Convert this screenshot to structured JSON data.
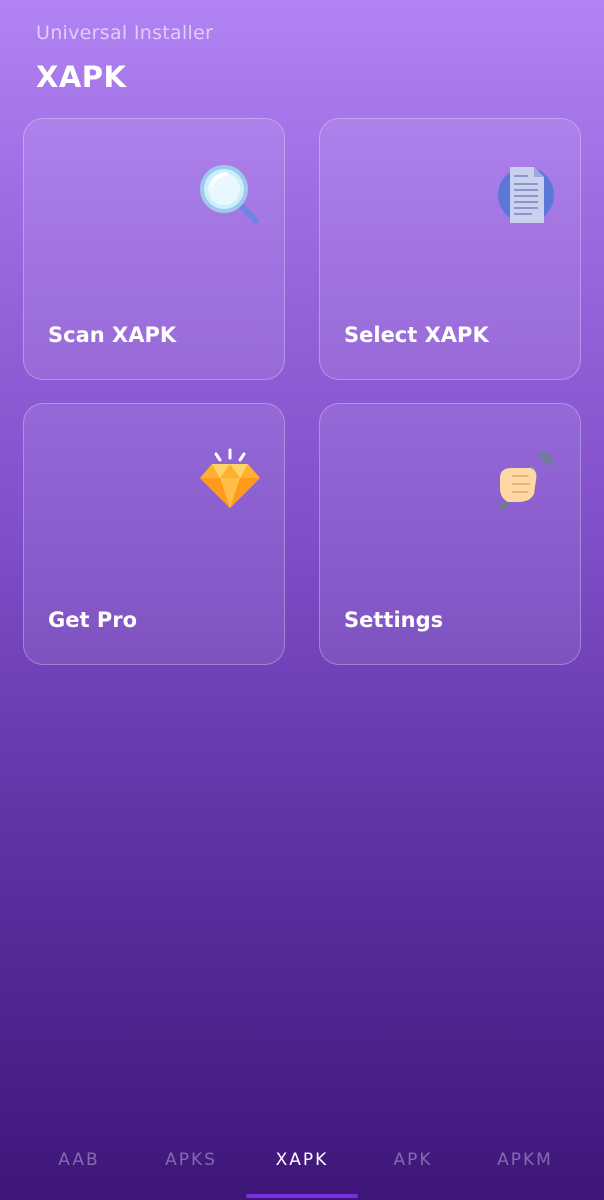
{
  "header": {
    "subtitle": "Universal Installer",
    "title": "XAPK"
  },
  "cards": [
    {
      "label": "Scan XAPK",
      "icon": "magnifier-icon"
    },
    {
      "label": "Select XAPK",
      "icon": "document-icon"
    },
    {
      "label": "Get Pro",
      "icon": "diamond-icon"
    },
    {
      "label": "Settings",
      "icon": "wrench-hand-icon"
    }
  ],
  "bottom_nav": {
    "tabs": [
      "AAB",
      "APKS",
      "XAPK",
      "APK",
      "APKM"
    ],
    "active": "XAPK"
  },
  "colors": {
    "bg_top": "#b183f3",
    "bg_bottom": "#3e1679",
    "indicator": "#7a2fe0",
    "diamond": "#ffb02e",
    "doc_blue": "#5b78d8"
  }
}
